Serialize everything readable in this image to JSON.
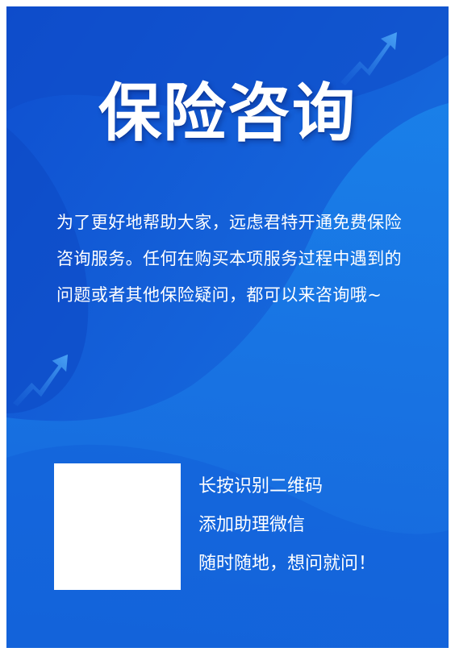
{
  "poster": {
    "title": "保险咨询",
    "intro": "为了更好地帮助大家，远虑君特开通免费保险咨询服务。任何在购买本项服务过程中遇到的问题或者其他保险疑问，都可以来咨询哦~",
    "qr_prompt": {
      "line1": "长按识别二维码",
      "line2": "添加助理微信",
      "line3": "随时随地，想问就问！"
    }
  },
  "colors": {
    "background": "#1257d6",
    "wave_light": "#1a7de6",
    "wave_dark": "#0c45b8",
    "text": "#ffffff",
    "qr_placeholder": "#ffffff"
  },
  "icons": [
    "trend-arrow-icon",
    "trend-arrow-icon"
  ]
}
